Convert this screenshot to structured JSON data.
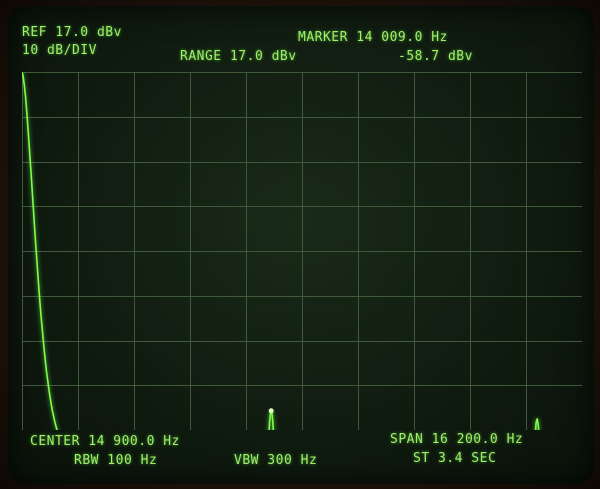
{
  "header": {
    "ref_level": "REF 17.0 dBv",
    "scale": "10 dB/DIV",
    "range": "RANGE 17.0 dBv",
    "marker_freq": "MARKER 14 009.0 Hz",
    "marker_level": "-58.7 dBv"
  },
  "footer": {
    "center_freq": "CENTER 14 900.0 Hz",
    "span": "SPAN 16 200.0 Hz",
    "rbw": "RBW 100 Hz",
    "vbw": "VBW 300 Hz",
    "sweep_time": "ST 3.4 SEC"
  },
  "colors": {
    "trace": "#7dff4a",
    "text": "#9ef06a",
    "grid": "#3f5a3a"
  },
  "trace": {
    "noise_floor_dbv": -69,
    "peaks": [
      {
        "freq_hz": 6800,
        "level_dbv": 17.0
      },
      {
        "freq_hz": 14009,
        "level_dbv": -58.7
      },
      {
        "freq_hz": 21700,
        "level_dbv": -60.5
      }
    ]
  }
}
